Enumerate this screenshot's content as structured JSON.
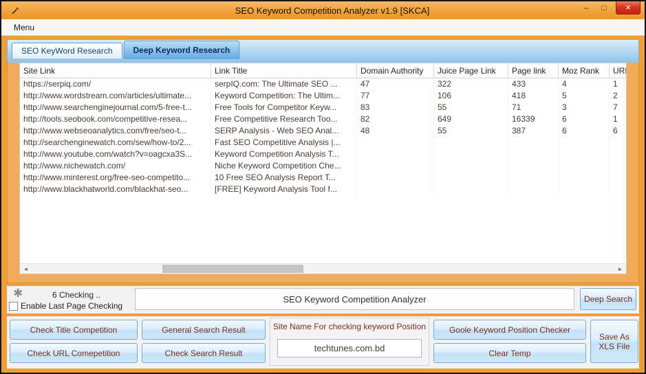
{
  "window": {
    "title": "SEO Keyword Competition Analyzer v1.9 [SKCA]",
    "menu_label": "Menu"
  },
  "icons": {
    "minimize": "–",
    "maximize": "□",
    "close": "×",
    "scroll_left": "◄",
    "scroll_right": "►",
    "spinner": "✱"
  },
  "tabs": [
    {
      "label": "SEO KeyWord Research"
    },
    {
      "label": "Deep Keyword Research"
    }
  ],
  "grid": {
    "columns": [
      "Site Link",
      "Link Title",
      "Domain Authority",
      "Juice Page Link",
      "Page link",
      "Moz Rank",
      "URL"
    ],
    "rows": [
      [
        "https://serpiq.com/",
        "serpIQ.com: The Ultimate SEO ...",
        "47",
        "322",
        "433",
        "4",
        "1"
      ],
      [
        "http://www.wordstream.com/articles/ultimate...",
        "Keyword Competition: The Ultim...",
        "77",
        "106",
        "418",
        "5",
        "2"
      ],
      [
        "http://www.searchenginejournal.com/5-free-t...",
        "Free Tools for Competitor Keyw...",
        "83",
        "55",
        "71",
        "3",
        "7"
      ],
      [
        "http://tools.seobook.com/competitive-resea...",
        "Free Competitive Research Too...",
        "82",
        "649",
        "16339",
        "6",
        "1"
      ],
      [
        "http://www.webseoanalytics.com/free/seo-t...",
        "SERP Analysis - Web SEO Anal...",
        "48",
        "55",
        "387",
        "6",
        "6"
      ],
      [
        "http://searchenginewatch.com/sew/how-to/2...",
        "Fast SEO Competitive Analysis |...",
        "",
        "",
        "",
        "",
        ""
      ],
      [
        "http://www.youtube.com/watch?v=oagcxa3S...",
        "Keyword Competition Analysis T...",
        "",
        "",
        "",
        "",
        ""
      ],
      [
        "http://www.nichewatch.com/",
        "Niche Keyword Competition Che...",
        "",
        "",
        "",
        "",
        ""
      ],
      [
        "http://www.minterest.org/free-seo-competito...",
        "10 Free SEO Analysis Report T...",
        "",
        "",
        "",
        "",
        ""
      ],
      [
        "http://www.blackhatworld.com/blackhat-seo...",
        "[FREE] Keyword Analysis Tool f...",
        "",
        "",
        "",
        "",
        ""
      ]
    ]
  },
  "status": {
    "checking_text": "6 Checking ..",
    "checkbox_label": "Enable Last Page Checking",
    "banner_text": "SEO Keyword Competition Analyzer",
    "deep_search_button": "Deep Search"
  },
  "actions": {
    "check_title": "Check Title Competition",
    "check_url": "Check URL Comepetition",
    "general_search": "General Search Result",
    "check_search": "Check Search Result",
    "group_label": "Site Name For checking keyword Position",
    "site_name_value": "techtunes.com.bd",
    "google_checker": "Goole Keyword Position Checker",
    "clear_temp": "Clear Temp",
    "save_xls": "Save As XLS File"
  }
}
